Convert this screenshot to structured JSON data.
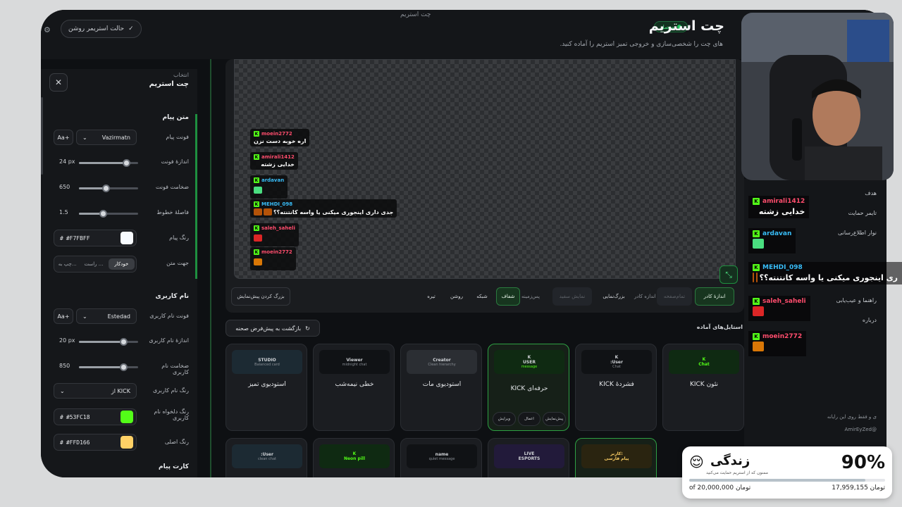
{
  "window": {
    "title": "چت استریم"
  },
  "header": {
    "title": "چت استریم",
    "subtitle": "های چت را شخصی‌سازی و خروجی تمیز استریم را آماده کنید.",
    "status": "متصل",
    "streamer_mode": "حالت استریمر روشن"
  },
  "sidebar": {
    "kicker": "انتخاب",
    "title": "چت استریم",
    "message_text": {
      "title": "متن پیام",
      "font_label": "فونت پیام",
      "font_value": "Vazirmatn",
      "aa": "Aa+",
      "size_label": "اندازهٔ فونت",
      "size_value": "24 px",
      "size_pct": 0.8,
      "weight_label": "ضخامت فونت",
      "weight_value": "650",
      "weight_pct": 0.45,
      "line_label": "فاصلهٔ خطوط",
      "line_value": "1.5",
      "line_pct": 0.4,
      "color_label": "رنگ پیام",
      "color_value": "#F7FBFF",
      "direction_label": "جهت متن",
      "direction_options": [
        "خودکار",
        "راست ...",
        "چپ به..."
      ]
    },
    "username": {
      "title": "نام کاربری",
      "font_label": "فونت نام کاربری",
      "font_value": "Estedad",
      "aa": "Aa+",
      "size_label": "اندازهٔ نام کاربری",
      "size_value": "20 px",
      "size_pct": 0.75,
      "weight_label": "ضخامت نام کاربری",
      "weight_value": "850",
      "weight_pct": 0.75,
      "color_label": "رنگ نام کاربری",
      "color_value": "از KICK",
      "custom_color_label": "رنگ دلخواه نام کاربری",
      "custom_color_value": "#53FC18",
      "main_color_label": "رنگ اصلی",
      "main_color_value": "#FFD166"
    },
    "card_title": "کارت پیام"
  },
  "preview": {
    "messages": [
      {
        "user": "moein2772",
        "color": "#ff4d6d",
        "text": "اره خوبه دست نزن"
      },
      {
        "user": "amirali1412",
        "color": "#ff4d6d",
        "text": "خدایی زشته"
      },
      {
        "user": "ardavan",
        "color": "#38bdf8",
        "text": ""
      },
      {
        "user": "MEHDI_098",
        "color": "#38bdf8",
        "text": "جدی داری اینجوری میکنی یا واسه کانتنته؟؟"
      },
      {
        "user": "saleh_saheli",
        "color": "#ff4d6d",
        "text": ""
      },
      {
        "user": "moein2772",
        "color": "#ff4d6d",
        "text": ""
      }
    ]
  },
  "controls": {
    "frame_size": "اندازهٔ کادر",
    "fullscreen_dim": "تمام‌صفحه",
    "frame_label": "اندازه کادر",
    "zoom": "بزرگ‌نمایی",
    "bg_dim": "نمایش سفید",
    "bg_label": "پس‌زمینه",
    "transparent": "شفاف",
    "grid": "شبکه",
    "light": "روشن",
    "dark": "تیره",
    "enlarge": "بزرگ کردن پیش‌نمایش"
  },
  "presets": {
    "reset": "بازگشت به پیش‌فرض صحنه",
    "title": "استایل‌های آماده",
    "cards": [
      {
        "thumb": "K",
        "thumb2": "Chat",
        "name": "نئون KICK"
      },
      {
        "thumb": "K",
        "thumb2": ":User",
        "thumb3": "Chat",
        "name": "فشردهٔ KICK"
      },
      {
        "thumb": "K",
        "thumb2": "USER",
        "thumb3": "message",
        "name": "حرفه‌ای KICK"
      },
      {
        "thumb": "Creator",
        "thumb2": "Clean hierarchy",
        "name": "استودیوی مات"
      },
      {
        "thumb": "Viewer",
        "thumb2": "midnight chat",
        "name": "خطی نیمه‌شب"
      },
      {
        "thumb": "STUDIO",
        "thumb2": "Balanced card",
        "name": "استودیوی تمیز"
      }
    ],
    "actions": [
      "پیش‌نمایش",
      "اعمال",
      "ویرایش"
    ],
    "row2": [
      {
        "thumb": "کاربر:",
        "thumb2": "پیام فارسی"
      },
      {
        "thumb": "LIVE",
        "thumb2": "ESPORTS"
      },
      {
        "thumb": "name",
        "thumb2": "quiet message"
      },
      {
        "thumb": "K",
        "thumb2": "Neon pill"
      },
      {
        "thumb": ":User",
        "thumb2": "clean chat"
      }
    ]
  },
  "right_panel": {
    "items": [
      "هدف",
      "تایمر حمایت",
      "نوار اطلاع‌رسانی",
      "راهنما و عیب‌یابی",
      "درباره"
    ],
    "footer_text": "ی و فقط روی این رایانه",
    "handle": "@AmirEyZed"
  },
  "overlay_chat": [
    {
      "user": "amirali1412",
      "color": "#ff4d6d",
      "text": "خدایی زشته"
    },
    {
      "user": "ardavan",
      "color": "#38bdf8",
      "text": ""
    },
    {
      "user": "MEHDI_098",
      "color": "#38bdf8",
      "text": "ری اینجوری میکنی یا واسه کانتنته؟؟"
    },
    {
      "user": "saleh_saheli",
      "color": "#ff4d6d",
      "text": ""
    },
    {
      "user": "moein2772",
      "color": "#ff4d6d",
      "text": ""
    }
  ],
  "goal_widget": {
    "percent": "90%",
    "title": "زندگی",
    "subtitle": "ممنون که از استریم حمایت می‌کنید",
    "progress": 0.9,
    "current": "17,959,155 تومان",
    "target": "of 20,000,000 تومان"
  },
  "colors": {
    "accent": "#2ea043",
    "kick": "#53FC18",
    "main": "#FFD166",
    "message": "#F7FBFF"
  }
}
